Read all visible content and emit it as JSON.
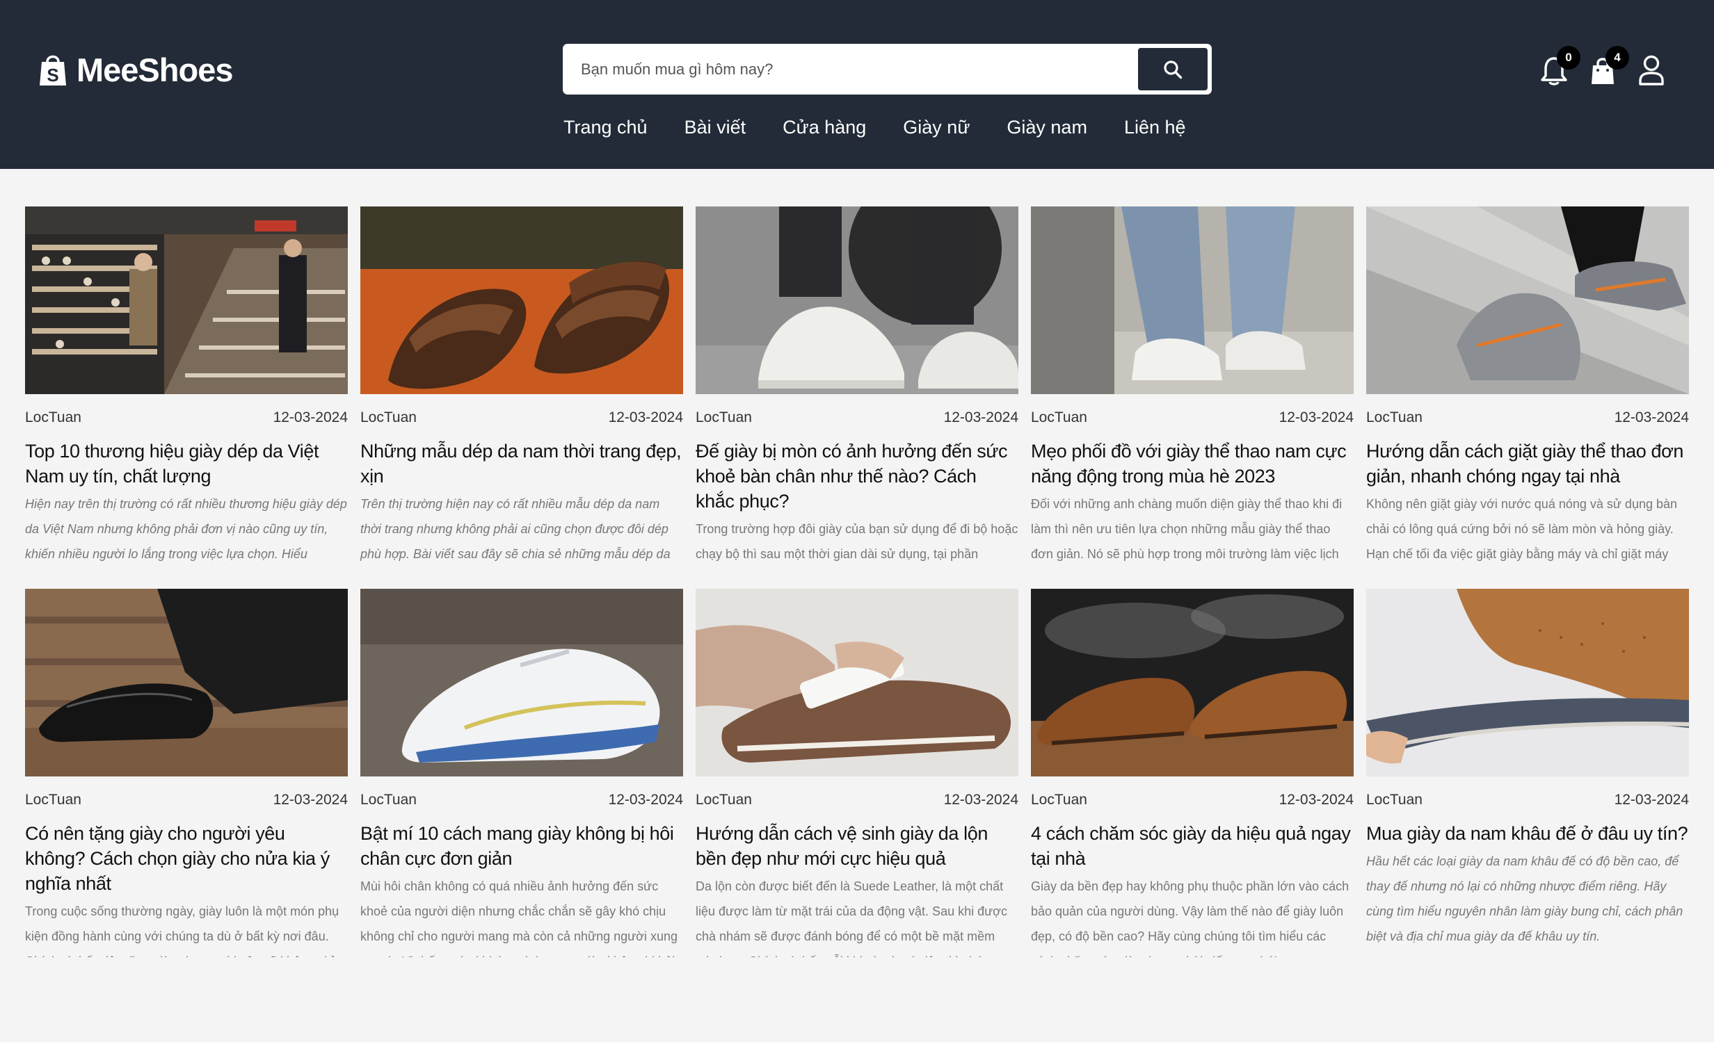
{
  "brand": {
    "name": "MeeShoes"
  },
  "search": {
    "placeholder": "Bạn muốn mua gì hôm nay?"
  },
  "nav": [
    "Trang chủ",
    "Bài viết",
    "Cửa hàng",
    "Giày nữ",
    "Giày nam",
    "Liên hệ"
  ],
  "header_icons": {
    "notifications_count": "0",
    "cart_count": "4"
  },
  "colors": {
    "header_bg": "#232b38",
    "page_bg": "#f4f4f4"
  },
  "posts": [
    {
      "author": "LocTuan",
      "date": "12-03-2024",
      "title": "Top 10 thương hiệu giày dép da Việt Nam uy tín, chất lượng",
      "excerpt": "Hiện nay trên thị trường có rất nhiều thương hiệu giày dép da Việt Nam nhưng không phải đơn vị nào cũng uy tín, khiến nhiều người lo lắng trong việc lựa chọn. Hiểu",
      "italic": true
    },
    {
      "author": "LocTuan",
      "date": "12-03-2024",
      "title": "Những mẫu dép da nam thời trang đẹp, xịn",
      "excerpt": "Trên thị trường hiện nay có rất nhiều mẫu dép da nam thời trang nhưng không phải ai cũng chọn được đôi dép phù hợp. Bài viết sau đây sẽ chia sẻ những mẫu dép da",
      "italic": true
    },
    {
      "author": "LocTuan",
      "date": "12-03-2024",
      "title": "Đế giày bị mòn có ảnh hưởng đến sức khoẻ bàn chân như thế nào? Cách khắc phục?",
      "excerpt": "Trong trường hợp đôi giày của bạn sử dụng để đi bộ hoặc chạy bộ thì sau một thời gian dài sử dụng, tại phần",
      "italic": false
    },
    {
      "author": "LocTuan",
      "date": "12-03-2024",
      "title": "Mẹo phối đồ với giày thể thao nam cực năng động trong mùa hè 2023",
      "excerpt": "Đối với những anh chàng muốn diện giày thể thao khi đi làm thì nên ưu tiên lựa chọn những mẫu giày thể thao đơn giản. Nó sẽ phù hợp trong môi trường làm việc lịch",
      "italic": false
    },
    {
      "author": "LocTuan",
      "date": "12-03-2024",
      "title": "Hướng dẫn cách giặt giày thể thao đơn giản, nhanh chóng ngay tại nhà",
      "excerpt": "Không nên giặt giày với nước quá nóng và sử dụng bàn chải có lông quá cứng bởi nó sẽ làm mòn và hỏng giày. Hạn chế tối đa việc giặt giày bằng máy và chỉ giặt máy",
      "italic": false
    },
    {
      "author": "LocTuan",
      "date": "12-03-2024",
      "title": "Có nên tặng giày cho người yêu không? Cách chọn giày cho nửa kia ý nghĩa nhất",
      "excerpt": "Trong cuộc sống thường ngày, giày luôn là một món phụ kiện đồng hành cùng với chúng ta dù ở bất kỳ nơi đâu. Chính vì thế, việc tặng giày cho người yêu sẽ không chỉ thể hiện được tình yêu thương mà còn thể hiện sự thấu hiểu và quan tâm của mình dành cho người ấy.",
      "italic": false
    },
    {
      "author": "LocTuan",
      "date": "12-03-2024",
      "title": "Bật mí 10 cách mang giày không bị hôi chân cực đơn giản",
      "excerpt": "Mùi hôi chân không có quá nhiều ảnh hưởng đến sức khoẻ của người diện nhưng chắc chắn sẽ gây khó chịu không chỉ cho người mang mà còn cả những người xung quanh. Vì thế, trước khi tìm cách mang giày không bị hôi chân thì chúng ta cần tìm hiểu nguyên nhân xuất hiện tình trạng này nhé.",
      "italic": false
    },
    {
      "author": "LocTuan",
      "date": "12-03-2024",
      "title": "Hướng dẫn cách vệ sinh giày da lộn bền đẹp như mới cực hiệu quả",
      "excerpt": "Da lộn còn được biết đến là Suede Leather, là một chất liệu được làm từ mặt trái của da động vật. Sau khi được chà nhám sẽ được đánh bóng để có một bề mặt mềm mịn hơn. Chính vì thế, mỗi khi sờ vào da lộn thì chúng ta luôn có một cảm giác mềm mại như những sợi lông rất nhỏ \"nhảy múa\" trên tay.",
      "italic": false
    },
    {
      "author": "LocTuan",
      "date": "12-03-2024",
      "title": "4 cách chăm sóc giày da hiệu quả ngay tại nhà",
      "excerpt": "Giày da bền đẹp hay không phụ thuộc phần lớn vào cách bảo quản của người dùng. Vậy làm thế nào để giày luôn đẹp, có độ bền cao? Hãy cùng chúng tôi tìm hiểu các cách chăm sóc giày da qua bài viết sau nhé!",
      "italic": false
    },
    {
      "author": "LocTuan",
      "date": "12-03-2024",
      "title": "Mua giày da nam khâu đế ở đâu uy tín?",
      "excerpt": "Hầu hết các loại giày da nam khâu đế có độ bền cao, để thay đế nhưng nó lại có những nhược điểm riêng. Hãy cùng tìm hiểu nguyên nhân làm giày bung chỉ, cách phân biệt và địa chỉ mua giày da đế khâu uy tín.",
      "italic": true
    }
  ]
}
